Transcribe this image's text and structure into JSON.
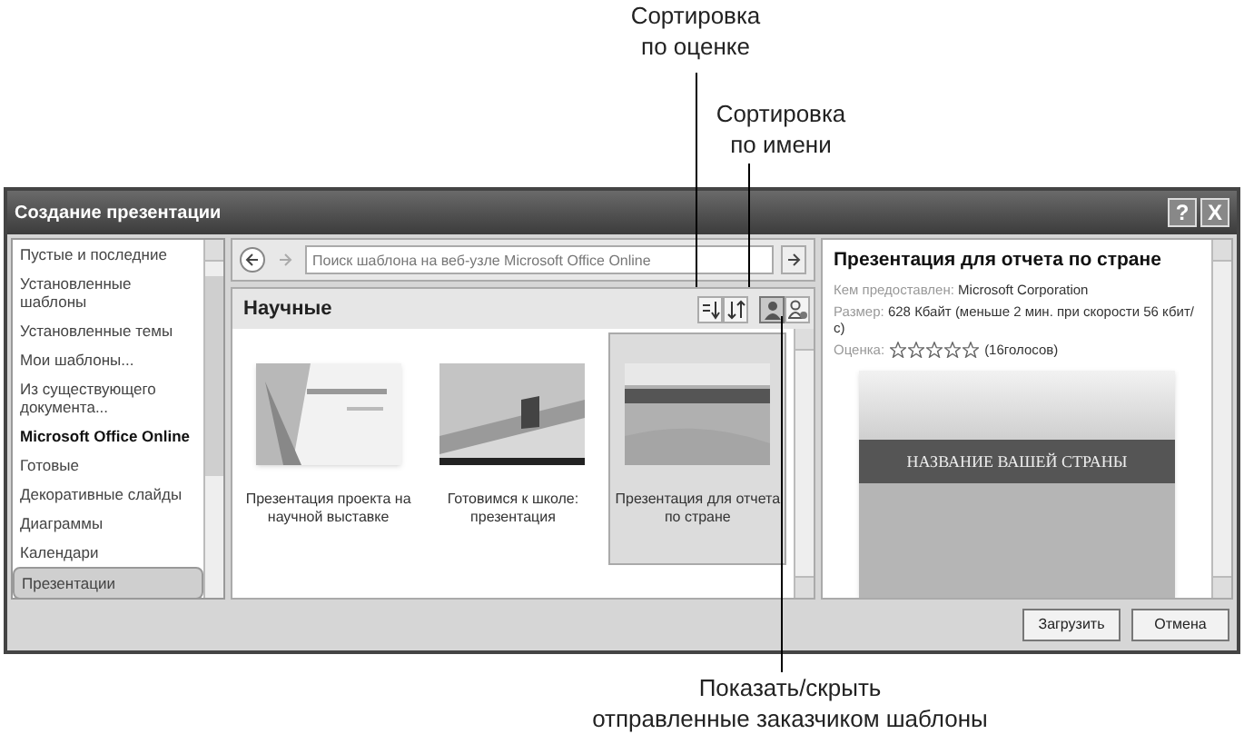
{
  "callouts": {
    "top_left": "Сортировка по оценке",
    "top_right": "Сортировка по имени",
    "bottom": [
      "Показать/скрыть",
      "отправленные заказчиком шаблоны"
    ]
  },
  "window": {
    "title": "Создание презентации",
    "help": "?",
    "close": "X"
  },
  "sidebar": {
    "items": [
      {
        "label": "Пустые и последние",
        "kind": "item",
        "selected": false
      },
      {
        "label": "Установленные шаблоны",
        "kind": "item",
        "selected": false
      },
      {
        "label": "Установленные темы",
        "kind": "item",
        "selected": false
      },
      {
        "label": "Мои шаблоны...",
        "kind": "item",
        "selected": false
      },
      {
        "label": "Из существующего документа...",
        "kind": "item",
        "selected": false
      },
      {
        "label": "Microsoft Office Online",
        "kind": "heading",
        "selected": false
      },
      {
        "label": "Готовые",
        "kind": "item",
        "selected": false
      },
      {
        "label": "Декоративные слайды",
        "kind": "item",
        "selected": false
      },
      {
        "label": "Диаграммы",
        "kind": "item",
        "selected": false
      },
      {
        "label": "Календари",
        "kind": "item",
        "selected": false
      },
      {
        "label": "Презентации",
        "kind": "item",
        "selected": true
      }
    ]
  },
  "search": {
    "placeholder": "Поиск шаблона на веб-узле Microsoft Office Online"
  },
  "gallery": {
    "title": "Научные",
    "sort_buttons": [
      {
        "kind": "rating"
      },
      {
        "kind": "name"
      }
    ],
    "filter_buttons": [
      {
        "kind": "all",
        "selected": true
      },
      {
        "kind": "customer",
        "selected": false
      }
    ],
    "templates": [
      {
        "name": "Презентация проекта на научной выставке",
        "kind": "light",
        "selected": false
      },
      {
        "name": "Готовимся к школе: презентация",
        "kind": "dark",
        "selected": false
      },
      {
        "name": "Презентация для отчета по стране",
        "kind": "banner",
        "selected": true
      }
    ]
  },
  "details": {
    "title": "Презентация для отчета по стране",
    "provider_label": "Кем предоставлен:",
    "provider": "Microsoft Corporation",
    "size_label": "Размер:",
    "size": "628 Кбайт (меньше 2 мин. при скорости 56 кбит/с)",
    "rating_label": "Оценка:",
    "stars": 0,
    "votes": "(16голосов)",
    "preview_title": "НАЗВАНИЕ ВАШЕЙ СТРАНЫ"
  },
  "buttons": [
    "Загрузить",
    "Отмена"
  ]
}
